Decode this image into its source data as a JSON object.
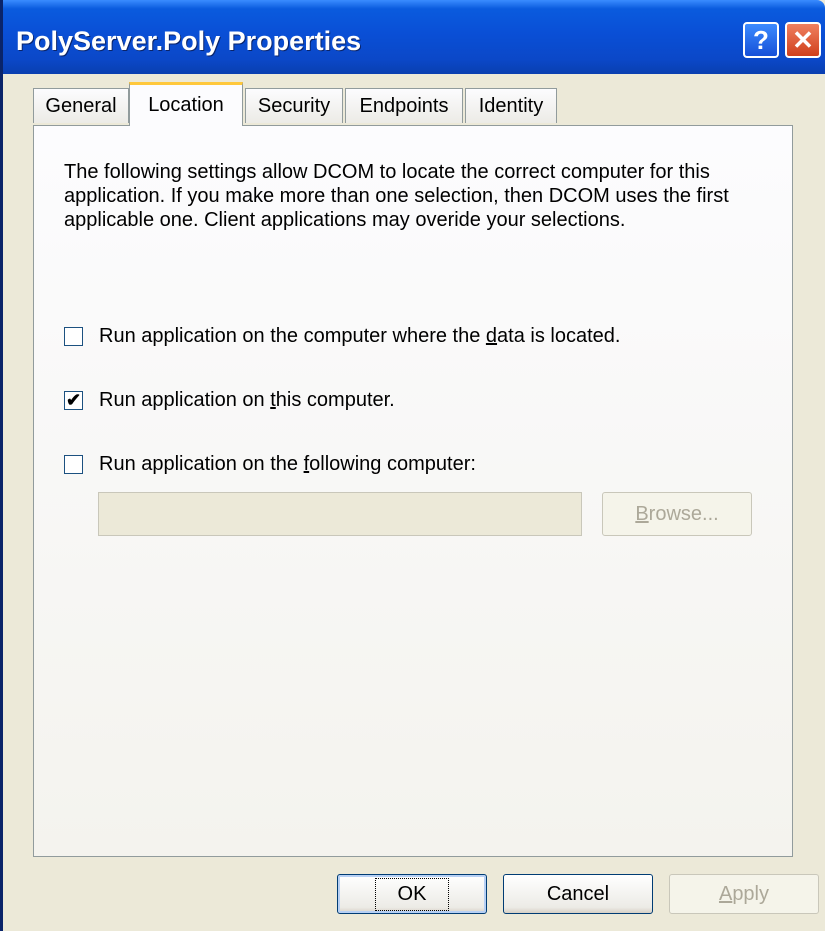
{
  "window": {
    "title": "PolyServer.Poly Properties",
    "help_symbol": "?",
    "close_symbol": "✕"
  },
  "tabs": [
    {
      "label": "General",
      "active": false
    },
    {
      "label": "Location",
      "active": true
    },
    {
      "label": "Security",
      "active": false
    },
    {
      "label": "Endpoints",
      "active": false
    },
    {
      "label": "Identity",
      "active": false
    }
  ],
  "location": {
    "description": "The following settings allow DCOM to locate the correct computer for this application. If you make more than one selection, then DCOM uses the first applicable one. Client applications may overide your selections.",
    "option1": {
      "before": "Run application on the computer where the ",
      "underlined": "d",
      "after": "ata is located.",
      "checked": false
    },
    "option2": {
      "before": "Run application on ",
      "underlined": "t",
      "after": "his computer.",
      "checked": true
    },
    "option3": {
      "before": "Run application on the ",
      "underlined": "f",
      "after": "ollowing computer:",
      "checked": false
    },
    "computer_field_value": "",
    "browse": {
      "underlined": "B",
      "rest": "rowse..."
    }
  },
  "buttons": {
    "ok": "OK",
    "cancel": "Cancel",
    "apply": {
      "underlined": "A",
      "rest": "pply"
    }
  },
  "check_mark": "✔"
}
